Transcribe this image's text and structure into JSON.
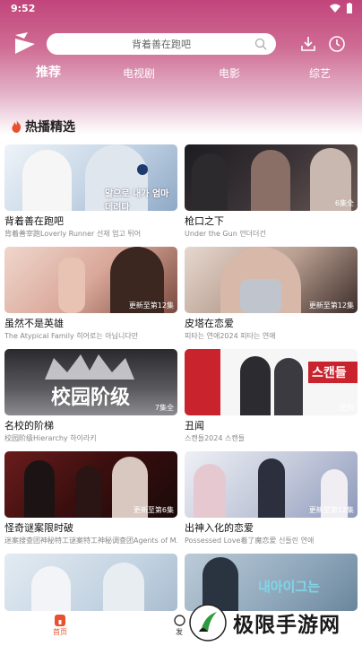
{
  "status": {
    "time": "9:52"
  },
  "search": {
    "placeholder": "背着善在跑吧"
  },
  "tabs": [
    {
      "label": "推荐",
      "active": true
    },
    {
      "label": "电视剧",
      "active": false
    },
    {
      "label": "电影",
      "active": false
    },
    {
      "label": "综艺",
      "active": false
    }
  ],
  "section": {
    "title": "热播精选"
  },
  "cards": [
    {
      "title": "背着善在跑吧",
      "subtitle": "背着善宰跑Loverly Runner 선재 업고 튀어",
      "badge": "",
      "overlay": "알으로 내가 엄마 데려다",
      "colors": [
        "#e8eef5",
        "#9fb9d6"
      ]
    },
    {
      "title": "枪口之下",
      "subtitle": "Under the Gun 언더더건",
      "badge": "6集全",
      "overlay": "",
      "colors": [
        "#2a2a2e",
        "#6b5a55"
      ]
    },
    {
      "title": "虽然不是英雄",
      "subtitle": "The Atypical Family 히어로는 아닙니다만",
      "badge": "更新至第12集",
      "overlay": "",
      "colors": [
        "#d9a89a",
        "#7a4a3e"
      ]
    },
    {
      "title": "皮塔在恋爱",
      "subtitle": "피타는 연애2024 피타는 연애",
      "badge": "更新至第12集",
      "overlay": "",
      "colors": [
        "#c9b8ae",
        "#3d2d2a"
      ]
    },
    {
      "title": "名校的阶梯",
      "subtitle": "校园阶级Hierarchy 하이라키",
      "badge": "7集全",
      "overlay": "校园阶级",
      "colors": [
        "#3a3a3e",
        "#8c8c90"
      ]
    },
    {
      "title": "丑闻",
      "subtitle": "스캔들2024 스캔들",
      "badge": "更新",
      "overlay": "스캔들",
      "colors": [
        "#f4f4f4",
        "#c9232e"
      ]
    },
    {
      "title": "怪奇谜案限时破",
      "subtitle": "迷案搜查团神秘特工谜案特工神秘调查团Agents of M...",
      "badge": "更新至第6集",
      "overlay": "",
      "colors": [
        "#5a1a1a",
        "#1a0a0a"
      ]
    },
    {
      "title": "出神入化的恋爱",
      "subtitle": "Possessed Love着了魔恋爱 신들린 연애",
      "badge": "更新至第12集",
      "overlay": "",
      "colors": [
        "#d8dce6",
        "#9aa6c4"
      ]
    },
    {
      "title": "",
      "subtitle": "",
      "badge": "",
      "overlay": "",
      "colors": [
        "#d6e1ea",
        "#b8c8d8"
      ]
    },
    {
      "title": "",
      "subtitle": "",
      "badge": "",
      "overlay": "내아이그는",
      "colors": [
        "#c8d6e0",
        "#7a96aa"
      ]
    }
  ],
  "nav": [
    {
      "label": "首页",
      "active": true
    },
    {
      "label": "发",
      "active": false
    }
  ],
  "watermark": {
    "text": "极限手游网"
  },
  "colors": {
    "accent": "#e8502f",
    "header_top": "#c1447a",
    "header_mid": "#cf6c94"
  }
}
